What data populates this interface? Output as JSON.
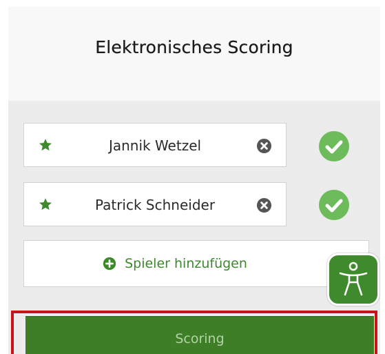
{
  "header": {
    "title": "Elektronisches Scoring"
  },
  "players": [
    {
      "name": "Jannik Wetzel",
      "icon": "star-icon",
      "remove_icon": "close-circle-icon",
      "status_icon": "check-circle-icon"
    },
    {
      "name": "Patrick Schneider",
      "icon": "star-icon",
      "remove_icon": "close-circle-icon",
      "status_icon": "check-circle-icon"
    }
  ],
  "add_player": {
    "label": "Spieler hinzufügen",
    "icon": "plus-circle-icon"
  },
  "accessibility": {
    "icon": "accessibility-icon"
  },
  "scoring_button": {
    "label": "Scoring"
  },
  "colors": {
    "brand_green": "#3d7e27",
    "check_green": "#6ebb5c",
    "highlight_red": "#c9121b",
    "label_green": "#3a8a2a"
  }
}
